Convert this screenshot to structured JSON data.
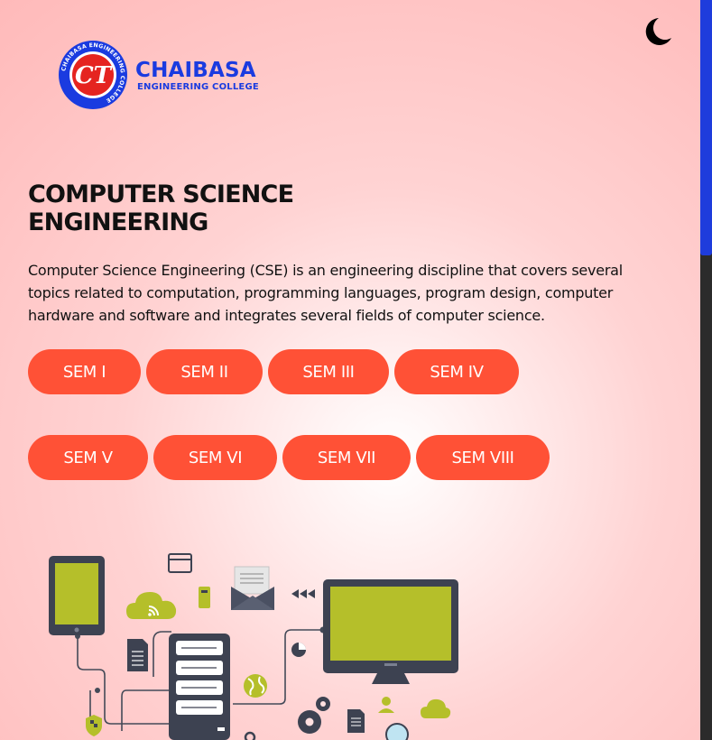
{
  "header": {
    "theme_toggle_icon": "moon-icon",
    "logo": {
      "emblem_icon": "college-emblem-icon",
      "emblem_ring_text": "CHAIBASA ENGINEERING COLLEGE",
      "emblem_monogram": "CT",
      "name": "CHAIBASA",
      "subtitle": "ENGINEERING COLLEGE",
      "brand_color": "#1a3be0"
    }
  },
  "main": {
    "title": "COMPUTER SCIENCE ENGINEERING",
    "description": "Computer Science Engineering (CSE) is an engineering discipline that covers several topics related to computation, programming languages, program design, computer hardware and software and integrates several fields of computer science.",
    "semesters": [
      {
        "label": "SEM I"
      },
      {
        "label": "SEM II"
      },
      {
        "label": "SEM III"
      },
      {
        "label": "SEM IV"
      },
      {
        "label": "SEM V"
      },
      {
        "label": "SEM VI"
      },
      {
        "label": "SEM VII"
      },
      {
        "label": "SEM VIII"
      }
    ],
    "button_color": "#ff5136",
    "illustration_icon": "computer-network-illustration"
  },
  "colors": {
    "accent": "#ff5136",
    "scrollbar_thumb": "#1e3cdc",
    "illustration_green": "#b5bf2a",
    "illustration_dark": "#3d4251"
  }
}
